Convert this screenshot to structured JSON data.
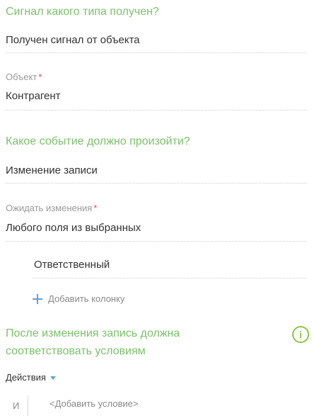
{
  "signal_section": {
    "title": "Сигнал какого типа получен?",
    "value": "Получен сигнал от объекта"
  },
  "object_field": {
    "label": "Объект",
    "required_mark": "*",
    "value": "Контрагент"
  },
  "event_section": {
    "title": "Какое событие должно произойти?",
    "value": "Изменение записи"
  },
  "wait_field": {
    "label": "Ожидать изменения",
    "required_mark": "*",
    "value": "Любого поля из выбранных"
  },
  "columns": {
    "items": [
      "Ответственный"
    ],
    "add_label": "Добавить колонку"
  },
  "condition_section": {
    "title_line1": "После изменения запись должна",
    "title_line2": "соответствовать условиям",
    "info_icon": "i"
  },
  "actions": {
    "label": "Действия"
  },
  "conditions": {
    "logic": "И",
    "add_label": "<Добавить условие>"
  },
  "colors": {
    "section_title": "#7cc16b",
    "required": "#e24c4c",
    "accent": "#5ea0d6",
    "info": "#8cc83e"
  }
}
